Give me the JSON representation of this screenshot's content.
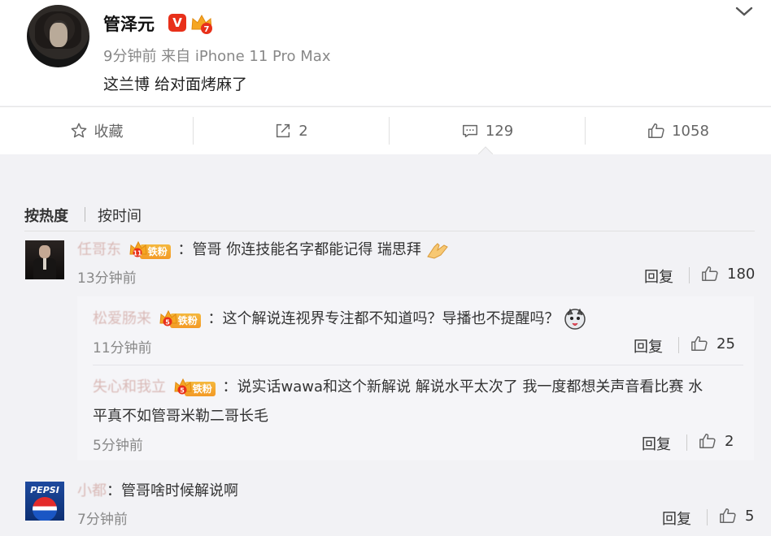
{
  "post": {
    "author": "管泽元",
    "verified_badge": "V",
    "fan_level": "7",
    "meta": "9分钟前 来自 iPhone 11 Pro Max",
    "content": "这兰博 给对面烤麻了"
  },
  "actions": {
    "favorite_label": "收藏",
    "repost_count": "2",
    "comment_count": "129",
    "like_count": "1058"
  },
  "sort": {
    "hot": "按热度",
    "time": "按时间"
  },
  "comments": [
    {
      "user": "任哥东",
      "fan_level": "11",
      "fan_label": "铁粉",
      "text": "：管哥 你连技能名字都能记得 瑞思拜",
      "time": "13分钟前",
      "reply_label": "回复",
      "likes": "180",
      "replies": [
        {
          "user": "松爱肠来",
          "fan_level": "5",
          "fan_label": "铁粉",
          "text": "：这个解说连视界专注都不知道吗？导播也不提醒吗？",
          "time": "11分钟前",
          "reply_label": "回复",
          "likes": "25"
        },
        {
          "user": "失心和我立",
          "fan_level": "5",
          "fan_label": "铁粉",
          "text": "：说实话wawa和这个新解说 解说水平太次了 我一度都想关声音看比赛 水",
          "text2": "平真不如管哥米勒二哥长毛",
          "time": "5分钟前",
          "reply_label": "回复",
          "likes": "2"
        }
      ]
    },
    {
      "user": "小都",
      "text": "：管哥啥时候解说啊",
      "time": "7分钟前",
      "reply_label": "回复",
      "likes": "5",
      "avatar_text": "PEPSI"
    }
  ],
  "colors": {
    "accent_orange": "#f39a26",
    "verified_red": "#e8301a",
    "text_gray": "#888888"
  }
}
